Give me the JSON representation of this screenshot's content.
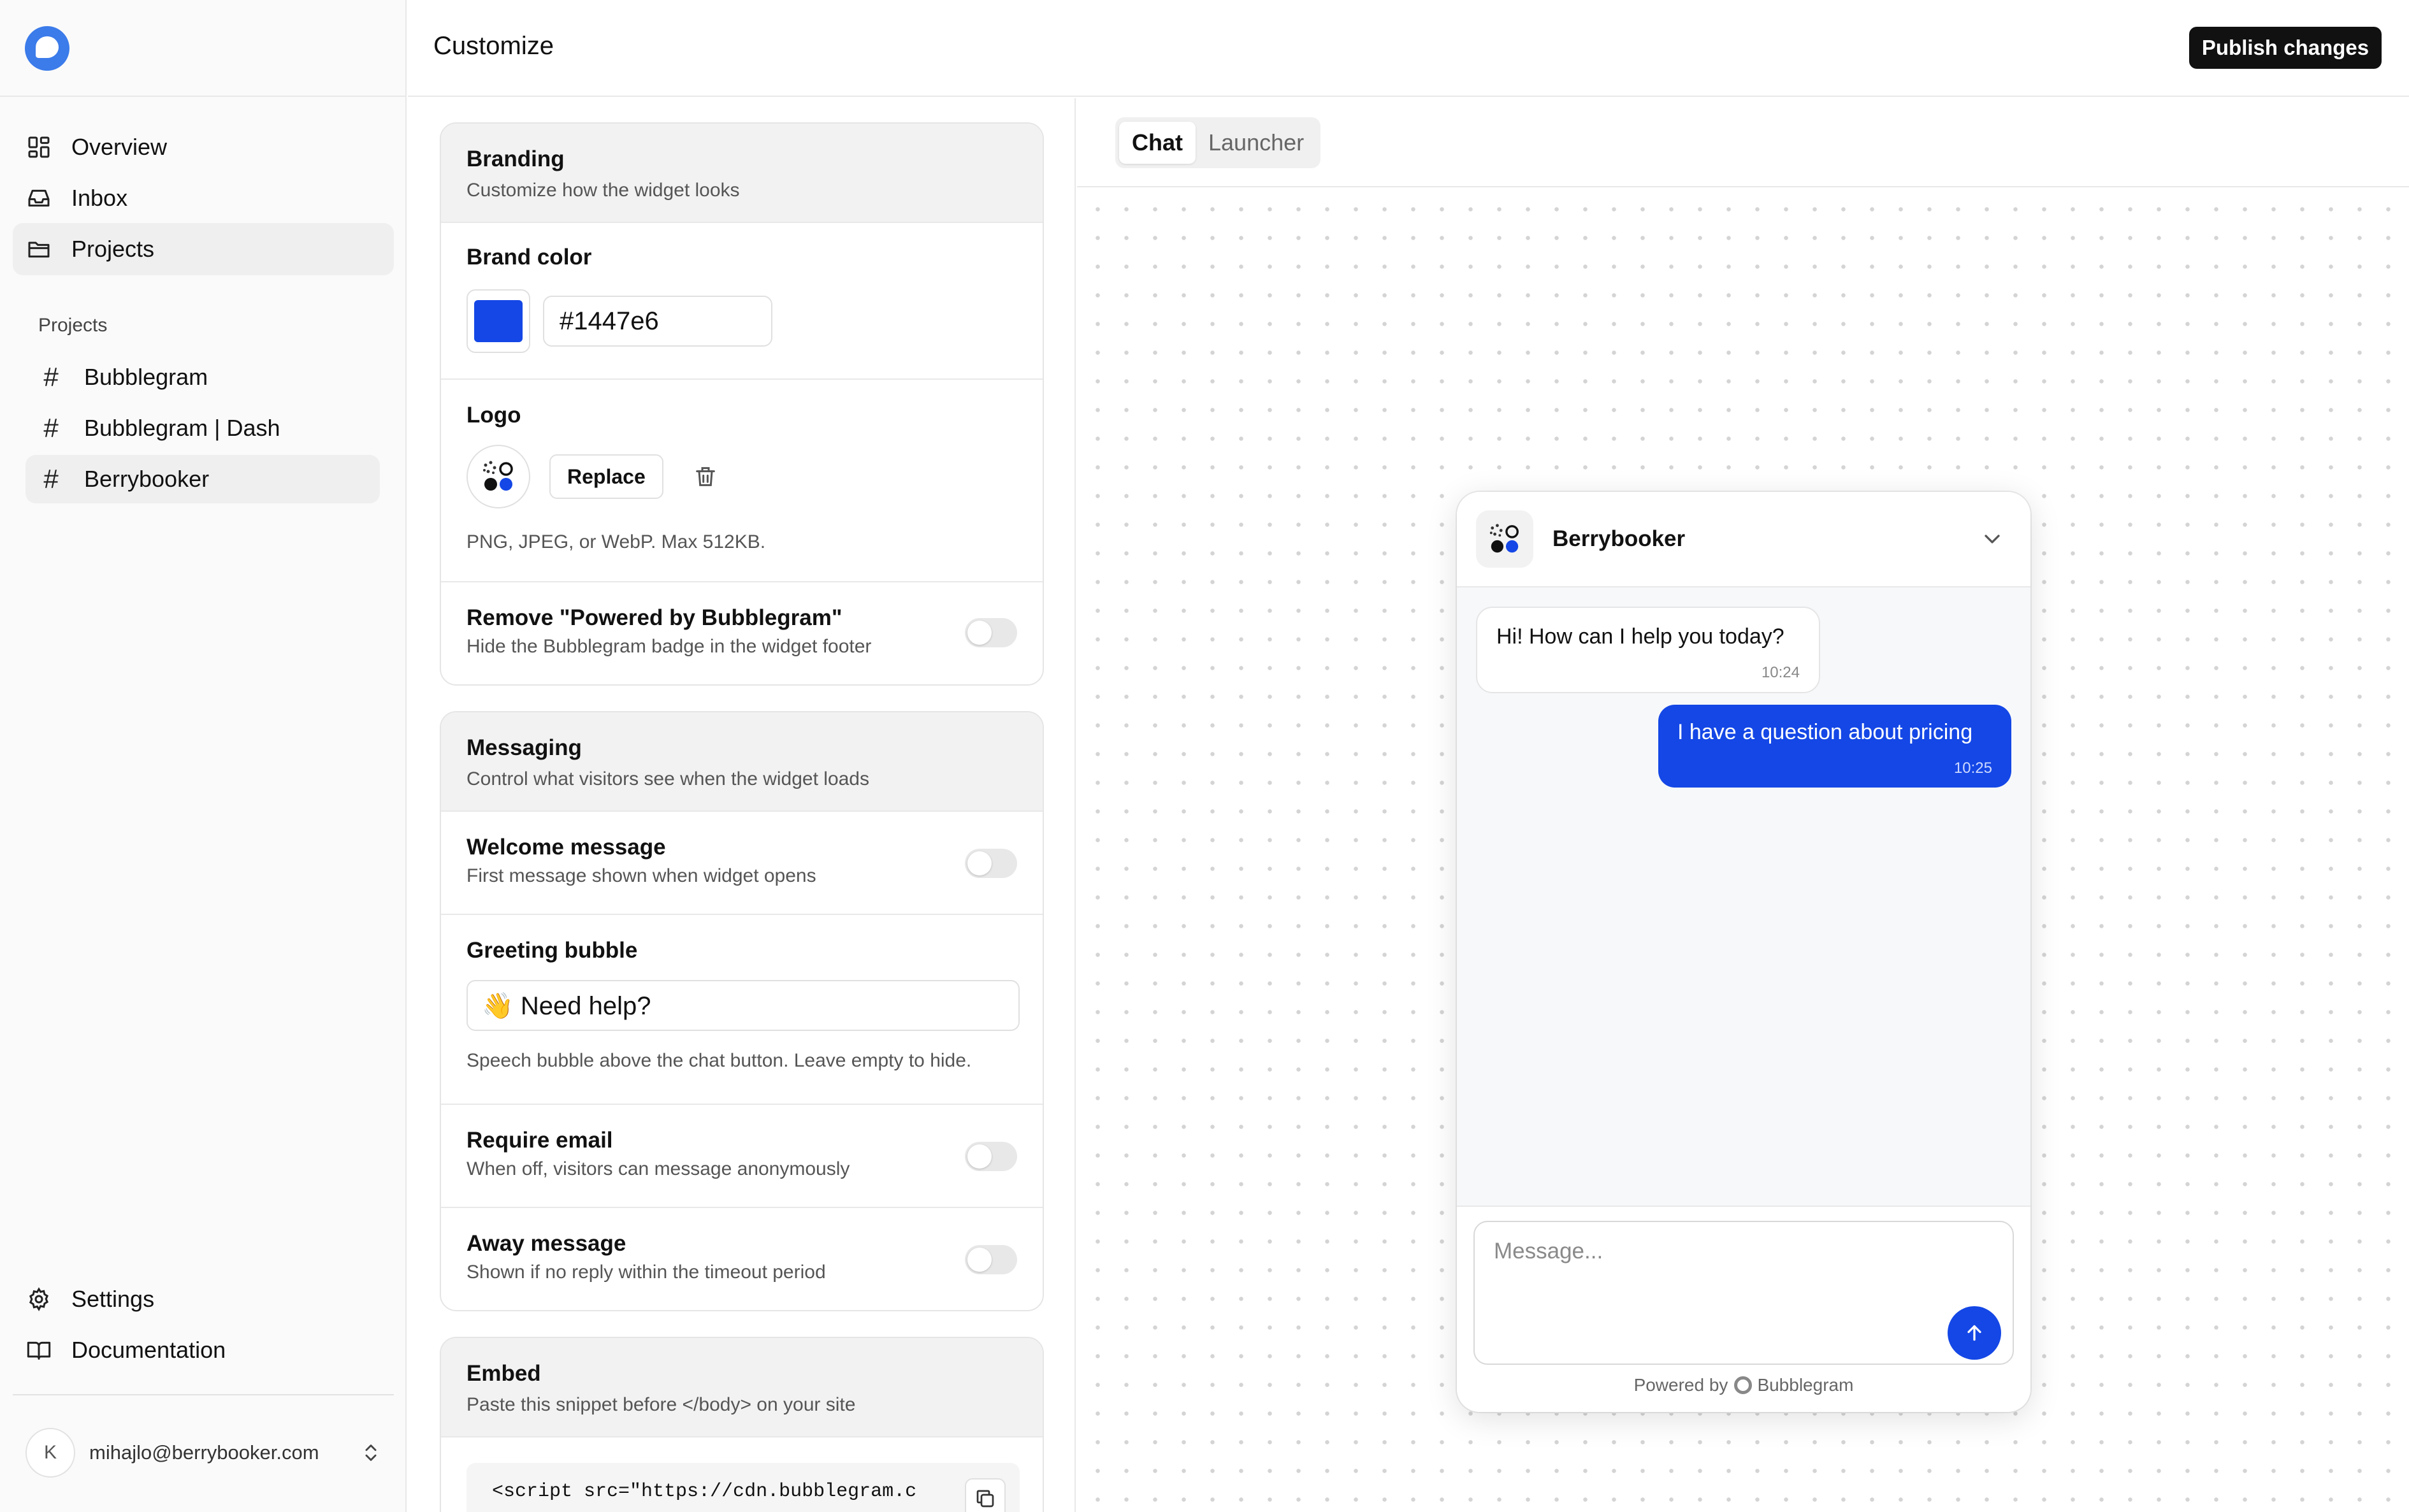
{
  "sidebar": {
    "nav": [
      {
        "label": "Overview",
        "icon": "dashboard-icon"
      },
      {
        "label": "Inbox",
        "icon": "inbox-icon"
      },
      {
        "label": "Projects",
        "icon": "folder-icon"
      }
    ],
    "section_label": "Projects",
    "projects": [
      {
        "label": "Bubblegram"
      },
      {
        "label": "Bubblegram | Dash"
      },
      {
        "label": "Berrybooker"
      }
    ],
    "bottom_nav": [
      {
        "label": "Settings",
        "icon": "gear-icon"
      },
      {
        "label": "Documentation",
        "icon": "book-icon"
      }
    ],
    "user": {
      "initial": "K",
      "email": "mihajlo@berrybooker.com"
    }
  },
  "header": {
    "title": "Customize",
    "publish_label": "Publish changes"
  },
  "branding": {
    "title": "Branding",
    "subtitle": "Customize how the widget looks",
    "brand_color_label": "Brand color",
    "brand_color_value": "#1447e6",
    "logo_label": "Logo",
    "replace_label": "Replace",
    "logo_help": "PNG, JPEG, or WebP. Max 512KB.",
    "remove_badge_label": "Remove \"Powered by Bubblegram\"",
    "remove_badge_sub": "Hide the Bubblegram badge in the widget footer",
    "remove_badge_on": false
  },
  "messaging": {
    "title": "Messaging",
    "subtitle": "Control what visitors see when the widget loads",
    "welcome_label": "Welcome message",
    "welcome_sub": "First message shown when widget opens",
    "welcome_on": false,
    "greeting_label": "Greeting bubble",
    "greeting_value": "👋 Need help?",
    "greeting_help": "Speech bubble above the chat button. Leave empty to hide.",
    "require_email_label": "Require email",
    "require_email_sub": "When off, visitors can message anonymously",
    "require_email_on": false,
    "away_label": "Away message",
    "away_sub": "Shown if no reply within the timeout period",
    "away_on": false
  },
  "embed": {
    "title": "Embed",
    "subtitle": "Paste this snippet before </body> on your site",
    "code": "<script src=\"https://cdn.bubblegram.c"
  },
  "preview": {
    "tabs": [
      {
        "label": "Chat",
        "active": true
      },
      {
        "label": "Launcher",
        "active": false
      }
    ],
    "widget": {
      "name": "Berrybooker",
      "messages": [
        {
          "from": "agent",
          "text": "Hi! How can I help you today?",
          "time": "10:24"
        },
        {
          "from": "visitor",
          "text": "I have a question about pricing",
          "time": "10:25"
        }
      ],
      "input_placeholder": "Message...",
      "powered_prefix": "Powered by",
      "powered_brand": "Bubblegram"
    }
  },
  "colors": {
    "brand": "#1447e6",
    "app_logo": "#3b7bea",
    "publish_bg": "#111111"
  }
}
